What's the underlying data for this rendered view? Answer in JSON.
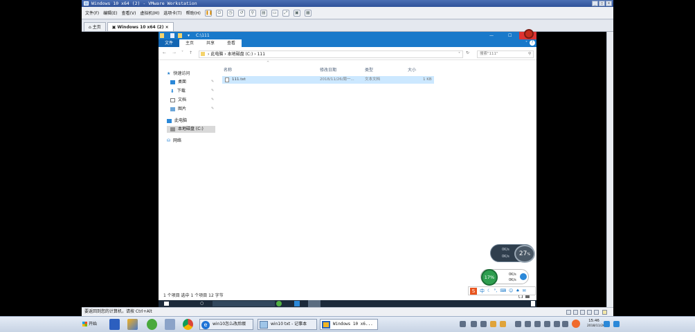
{
  "host": {
    "title": "Windows 10 x64 (2) - VMware Workstation",
    "menus": [
      "文件(F)",
      "编辑(E)",
      "查看(V)",
      "虚拟机(M)",
      "选项卡(T)",
      "帮助(H)"
    ],
    "tabs": [
      {
        "label": "主页"
      },
      {
        "label": "Windows 10 x64 (2)"
      }
    ],
    "status": "要返回到您的计算机，请按 Ctrl+Alt"
  },
  "guest": {
    "title": "C:\\111",
    "ribbon": {
      "file": "文件",
      "tabs": [
        "主页",
        "共享",
        "查看"
      ]
    },
    "address": {
      "parts": [
        "此电脑",
        "本地磁盘 (C:)",
        "111"
      ]
    },
    "search_placeholder": "搜索\"111\"",
    "nav": {
      "quick_access": "快速访问",
      "items": [
        "桌面",
        "下载",
        "文档",
        "图片"
      ],
      "this_pc": "此电脑",
      "local_disk": "本地磁盘 (C:)",
      "network": "网络"
    },
    "columns": {
      "name": "名称",
      "modified": "修改日期",
      "type": "类型",
      "size": "大小"
    },
    "files": [
      {
        "name": "111.txt",
        "modified": "2018/11/26/周一...",
        "type": "文本文档",
        "size": "1 KB"
      }
    ],
    "status": "1 个项目    选中 1 个项目  12 字节",
    "clock": "15:46"
  },
  "widgets": {
    "memory_percent": "27",
    "memory_unit": "%",
    "cpu_percent": "17%",
    "net_up": "0K/s",
    "net_down": "0K/s"
  },
  "taskbar": {
    "start_label": "开始",
    "tasks": [
      {
        "label": "win10怎么改后缀"
      },
      {
        "label": "win10 txt - 记事本"
      },
      {
        "label": "Windows 10 x6..."
      }
    ],
    "clock_time": "15:46",
    "clock_date": "2018/11/26"
  }
}
